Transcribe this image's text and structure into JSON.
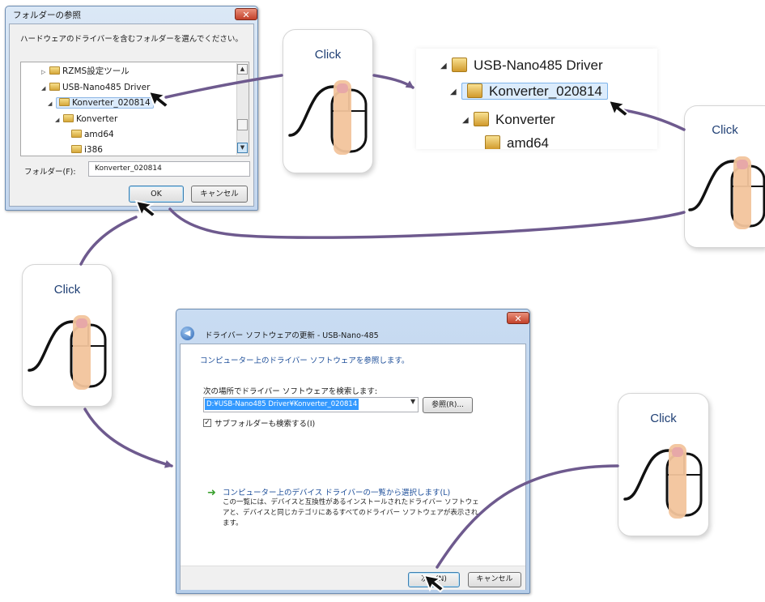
{
  "folder_dialog": {
    "title": "フォルダーの参照",
    "close_glyph": "✕",
    "prompt": "ハードウェアのドライバーを含むフォルダーを選んでください。",
    "tree_items": [
      "RZMS設定ツール",
      "USB-Nano485 Driver",
      "Konverter_020814",
      "Konverter",
      "amd64",
      "i386"
    ],
    "folder_label": "フォルダー(F):",
    "folder_value": "Konverter_020814",
    "ok_label": "OK",
    "cancel_label": "キャンセル"
  },
  "zoomed_tree": {
    "items": [
      "USB-Nano485 Driver",
      "Konverter_020814",
      "Konverter",
      "amd64"
    ]
  },
  "driver_dialog": {
    "title": "ドライバー ソフトウェアの更新 - USB-Nano-485",
    "close_glyph": "✕",
    "heading": "コンピューター上のドライバー ソフトウェアを参照します。",
    "search_label": "次の場所でドライバー ソフトウェアを検索します:",
    "path_value": "D:¥USB-Nano485 Driver¥Konverter_020814",
    "browse_label": "参照(R)...",
    "include_subfolders_label": "サブフォルダーも検索する(I)",
    "include_subfolders_checked": true,
    "pick_link": "コンピューター上のデバイス ドライバーの一覧から選択します(L)",
    "pick_desc": "この一覧には、デバイスと互換性があるインストールされたドライバー ソフトウェアと、デバイスと同じカテゴリにあるすべてのドライバー ソフトウェアが表示されます。",
    "next_label": "次へ(N)",
    "cancel_label": "キャンセル"
  },
  "click_cards": [
    "Click",
    "Click",
    "Click",
    "Click"
  ],
  "colors": {
    "arrow": "#6e5a8e",
    "card_text": "#1f3f74",
    "selection": "#dcebfc",
    "highlight": "#3399ff"
  }
}
